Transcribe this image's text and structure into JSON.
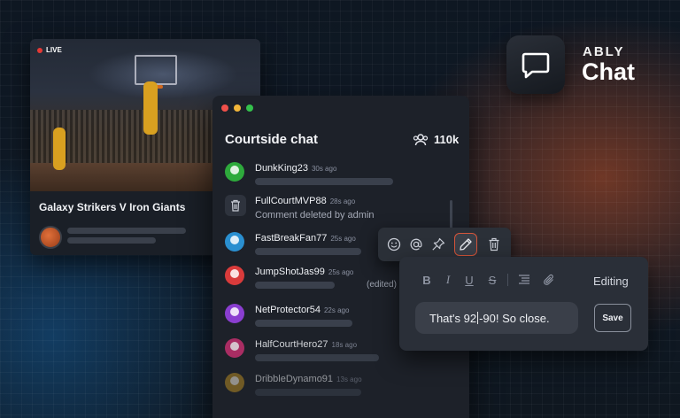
{
  "brand": {
    "name_small": "ABLY",
    "name_large": "Chat"
  },
  "video": {
    "live_label": "LIVE",
    "game_title": "Galaxy Strikers V Iron Giants"
  },
  "chat": {
    "title": "Courtside chat",
    "user_count": "110k",
    "messages": [
      {
        "user": "DunkKing23",
        "time": "30s ago",
        "avatar_color": "#2eaa3c",
        "bar": 0.78
      },
      {
        "user": "FullCourtMVP88",
        "time": "28s ago",
        "deleted_text": "Comment deleted by admin"
      },
      {
        "user": "FastBreakFan77",
        "time": "25s ago",
        "avatar_color": "#2a8fd0",
        "bar": 0.6
      },
      {
        "user": "JumpShotJas99",
        "time": "25s ago",
        "avatar_color": "#d93b3b",
        "bar": 0.45,
        "edited_label": "(edited)"
      },
      {
        "user": "NetProtector54",
        "time": "22s ago",
        "avatar_color": "#8a3ed0",
        "bar": 0.55
      },
      {
        "user": "HalfCourtHero27",
        "time": "18s ago",
        "avatar_color": "#c2306e",
        "bar": 0.7
      },
      {
        "user": "DribbleDynamo91",
        "time": "13s ago",
        "avatar_color": "#b58a22",
        "bar": 0.6
      }
    ]
  },
  "editor": {
    "status": "Editing",
    "text_before_caret": "That's 92",
    "text_after_caret": "-90! So close.",
    "save_label": "Save"
  },
  "colors": {
    "accent": "#d6553a",
    "window_bg": "#1d2129",
    "toolbar_bg": "#2b3038"
  }
}
